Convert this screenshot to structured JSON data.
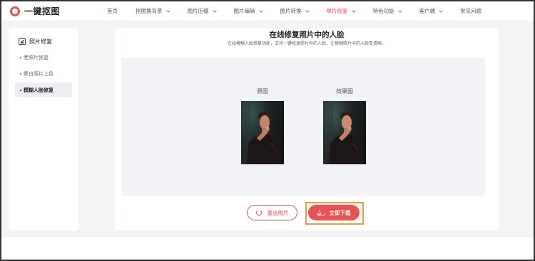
{
  "brand": {
    "name": "一键抠图",
    "accent": "#e94f4f"
  },
  "nav": {
    "items": [
      {
        "label": "首页",
        "has_menu": false,
        "active": false
      },
      {
        "label": "抠图换背景",
        "has_menu": true,
        "active": false
      },
      {
        "label": "图片压缩",
        "has_menu": true,
        "active": false
      },
      {
        "label": "图片编辑",
        "has_menu": true,
        "active": false
      },
      {
        "label": "图片转换",
        "has_menu": true,
        "active": false
      },
      {
        "label": "照片修复",
        "has_menu": true,
        "active": true
      },
      {
        "label": "特色功能",
        "has_menu": true,
        "active": false
      },
      {
        "label": "客户端",
        "has_menu": true,
        "active": false
      },
      {
        "label": "常见问题",
        "has_menu": false,
        "active": false
      }
    ]
  },
  "sidebar": {
    "title": "照片修复",
    "items": [
      {
        "label": "老照片修复",
        "selected": false
      },
      {
        "label": "黑白照片上色",
        "selected": false
      },
      {
        "label": "模糊人脸修复",
        "selected": true
      }
    ]
  },
  "main": {
    "title": "在线修复照片中的人脸",
    "subtitle": "在线模糊人脸修复功能，支持一键修复照片中的人脸，让模糊照片中的人脸变清晰。",
    "original_label": "原图",
    "result_label": "效果图",
    "reselect_label": "重选图片",
    "download_label": "立即下载"
  }
}
